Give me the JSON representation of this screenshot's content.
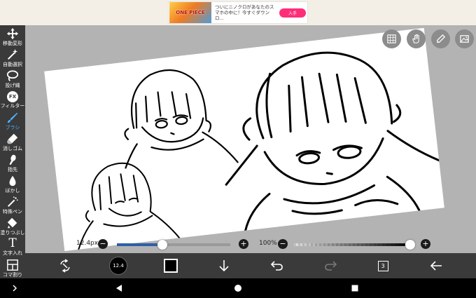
{
  "ad": {
    "thumb_text": "ONE PIECE",
    "text": "ついにニノクロがあなたのスマホの中に！今すぐダウンロ...",
    "button": "入手"
  },
  "toolbar": {
    "items": [
      {
        "label": "移動変形",
        "icon": "move-arrows-icon"
      },
      {
        "label": "自動選択",
        "icon": "magic-wand-icon"
      },
      {
        "label": "投げ縄",
        "icon": "lasso-icon"
      },
      {
        "label": "フィルター",
        "icon": "fx-icon",
        "glyph": "FX"
      },
      {
        "label": "ブラシ",
        "icon": "brush-icon",
        "active": true
      },
      {
        "label": "消しゴム",
        "icon": "eraser-icon"
      },
      {
        "label": "指先",
        "icon": "finger-smudge-icon"
      },
      {
        "label": "ぼかし",
        "icon": "blur-drop-icon"
      },
      {
        "label": "特殊ペン",
        "icon": "special-pen-icon"
      },
      {
        "label": "塗りつぶし",
        "icon": "fill-bucket-icon"
      },
      {
        "label": "文字入れ",
        "icon": "text-icon",
        "glyph": "T"
      },
      {
        "label": "コマ割り",
        "icon": "frame-divider-icon"
      }
    ]
  },
  "canvas": {
    "top_buttons": [
      "layer-visibility-icon",
      "hand-icon",
      "eyedropper-icon",
      "image-icon"
    ]
  },
  "brush": {
    "size_label": "12.4px",
    "size_percent": 40,
    "preview_label": "12.4",
    "color": "#000000"
  },
  "opacity": {
    "label": "100%",
    "percent": 100
  },
  "buttons": {
    "minus": "−",
    "plus": "+"
  },
  "layers": {
    "count": "3"
  },
  "colors": {
    "accent": "#4fb3ff",
    "toolbar_bg": "#3a3a3a",
    "workspace_bg": "#b3b3b3",
    "slider_fill": "#2d5ea8"
  }
}
